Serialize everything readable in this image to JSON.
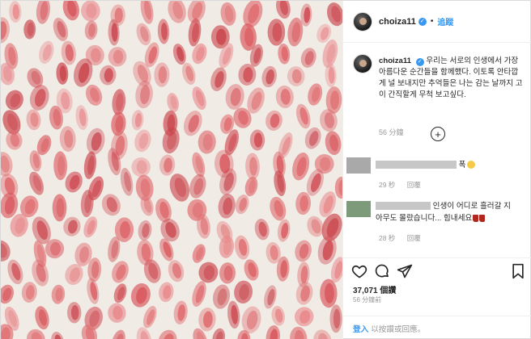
{
  "post": {
    "username": "choiza11",
    "verified_mark": "✓",
    "dot": "•",
    "follow_label": "追蹤",
    "image_icon": "lipstick-kiss-marks-photo"
  },
  "caption": {
    "username": "choiza11",
    "text": "우리는 서로의 인생에서 가장 아름다운 순간들을 함께했다. 이토록 안타깝게 널 보내지만 추억들은 나는 감는 날까지 고이 간직할게 무척 보고싶다.",
    "time": "56 分鐘"
  },
  "load_more": "+",
  "comments": [
    {
      "text": "폭",
      "emoji": "smiley",
      "time": "29 秒",
      "reply": "回覆"
    },
    {
      "line1": "인생이 어디로 흘러갈 지",
      "line2": "아무도 몰랐습니다... 힘내세요",
      "emoji": "red-boots",
      "time": "28 秒",
      "reply": "回覆"
    }
  ],
  "likes": "37,071 個讚",
  "timestamp": "56 分鐘前",
  "login": {
    "link": "登入",
    "text": "以按讚或回應。"
  }
}
